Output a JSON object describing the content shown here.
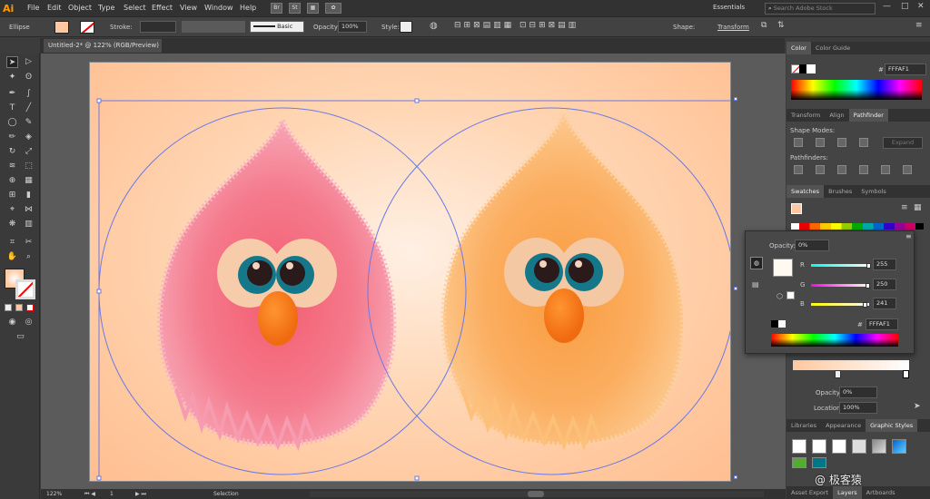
{
  "app": {
    "logo": "Ai"
  },
  "menubar": {
    "items": [
      "File",
      "Edit",
      "Object",
      "Type",
      "Select",
      "Effect",
      "View",
      "Window",
      "Help"
    ],
    "chips": [
      "Br",
      "St"
    ],
    "workspace": "Essentials",
    "search_placeholder": "Search Adobe Stock"
  },
  "control": {
    "object_type": "Ellipse",
    "stroke_label": "Stroke:",
    "brush_label": "Basic",
    "opacity_label": "Opacity:",
    "opacity_value": "100%",
    "style_label": "Style:",
    "shape_label": "Shape:",
    "transform_label": "Transform"
  },
  "document": {
    "tab_title": "Untitled-2* @ 122% (RGB/Preview)"
  },
  "status": {
    "zoom": "122%",
    "page": "1",
    "tool": "Selection"
  },
  "panels": {
    "color": {
      "tabs": [
        "Color",
        "Color Guide"
      ],
      "hex_label": "#",
      "hex": "FFFAF1"
    },
    "pathfinder": {
      "tabs": [
        "Transform",
        "Align",
        "Pathfinder"
      ],
      "shape_modes": "Shape Modes:",
      "pathfinders": "Pathfinders:",
      "expand": "Expand"
    },
    "swatches": {
      "tabs": [
        "Swatches",
        "Brushes",
        "Symbols"
      ]
    },
    "gradient": {
      "opacity_label": "Opacity:",
      "opacity_value": "0%",
      "location_label": "Location:",
      "location_value": "100%"
    },
    "graphic_styles": {
      "tabs": [
        "Libraries",
        "Appearance",
        "Graphic Styles"
      ]
    },
    "bottom_tabs": [
      "Asset Export",
      "Layers",
      "Artboards"
    ]
  },
  "flyout": {
    "opacity_label": "Opacity:",
    "opacity_value": "0%",
    "r_label": "R",
    "r_value": "255",
    "r_fraction": 1.0,
    "g_label": "G",
    "g_value": "250",
    "g_fraction": 0.98,
    "b_label": "B",
    "b_value": "241",
    "b_fraction": 0.945,
    "hex_label": "#",
    "hex": "FFFAF1"
  },
  "watermark": "@ 极客猿",
  "colors": {
    "fill_swatch": "#ffc8a0",
    "pink_creature": "#f06a7e",
    "orange_creature": "#fba552",
    "selection": "#6b79e6"
  }
}
